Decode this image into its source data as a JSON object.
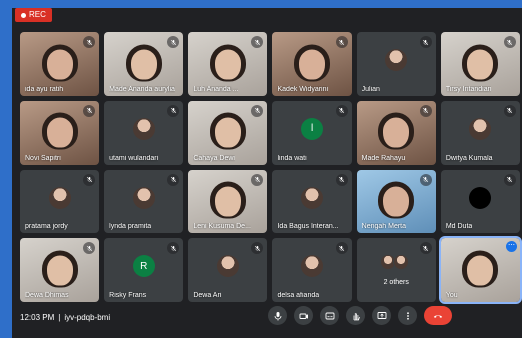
{
  "recording": {
    "label": "REC"
  },
  "tiles": [
    {
      "name": "ida ayu ratih",
      "kind": "video",
      "tone": "warm",
      "muted": true
    },
    {
      "name": "Made Ananda aurylia",
      "kind": "video",
      "tone": "light",
      "muted": true
    },
    {
      "name": "Luh Ananda ...",
      "kind": "video",
      "tone": "light",
      "muted": true
    },
    {
      "name": "Kadek Widyarini",
      "kind": "video",
      "tone": "warm",
      "muted": true
    },
    {
      "name": "Julian",
      "kind": "avatar",
      "avatar_color": "#5f6368",
      "muted": true
    },
    {
      "name": "Tirsy Intandian",
      "kind": "video",
      "tone": "light",
      "muted": true
    },
    {
      "name": "Novi Sapitri",
      "kind": "video",
      "tone": "warm",
      "muted": true
    },
    {
      "name": "utami wulandari",
      "kind": "avatar",
      "avatar_color": "#7a5c8a",
      "muted": true
    },
    {
      "name": "Cahaya Dewi",
      "kind": "video",
      "tone": "light",
      "muted": true
    },
    {
      "name": "linda wati",
      "kind": "letter",
      "letter": "l",
      "avatar_color": "#0b8043",
      "muted": true
    },
    {
      "name": "Made Rahayu",
      "kind": "video",
      "tone": "warm",
      "muted": true
    },
    {
      "name": "Dwitya Kumala",
      "kind": "avatar",
      "avatar_color": "#5f6368",
      "muted": true
    },
    {
      "name": "pratama jordy",
      "kind": "avatar",
      "avatar_color": "#5f6368",
      "muted": true
    },
    {
      "name": "lynda pramita",
      "kind": "avatar",
      "avatar_color": "#5f6368",
      "muted": true
    },
    {
      "name": "Leni Kusuma De...",
      "kind": "video",
      "tone": "light",
      "muted": true
    },
    {
      "name": "Ida Bagus Interan...",
      "kind": "avatar",
      "avatar_color": "#5f6368",
      "muted": true
    },
    {
      "name": "Nengah Merta",
      "kind": "video",
      "tone": "cool",
      "muted": true
    },
    {
      "name": "Md Duta",
      "kind": "avatar",
      "avatar_color": "#000000",
      "muted": true
    },
    {
      "name": "Dewa Dhimas",
      "kind": "video",
      "tone": "light",
      "muted": true
    },
    {
      "name": "Risky Frans",
      "kind": "letter",
      "letter": "R",
      "avatar_color": "#0b8043",
      "muted": true
    },
    {
      "name": "Dewa Ari",
      "kind": "avatar",
      "avatar_color": "#5f6368",
      "muted": true
    },
    {
      "name": "delsa afianda",
      "kind": "avatar",
      "avatar_color": "#5f6368",
      "muted": true
    },
    {
      "name": "2 others",
      "kind": "others",
      "muted": true
    },
    {
      "name": "You",
      "kind": "video",
      "tone": "light",
      "muted": false,
      "self": true
    }
  ],
  "meeting": {
    "time": "12:03 PM",
    "separator": "|",
    "code": "iyv-pdqb-bmi"
  },
  "controls": [
    "mic-icon",
    "camera-icon",
    "captions-icon",
    "raise-hand-icon",
    "present-icon",
    "more-options-icon",
    "hang-up-icon"
  ],
  "colors": {
    "hangup": "#ea4335",
    "recording": "#d93025",
    "accent": "#1a73e8"
  }
}
